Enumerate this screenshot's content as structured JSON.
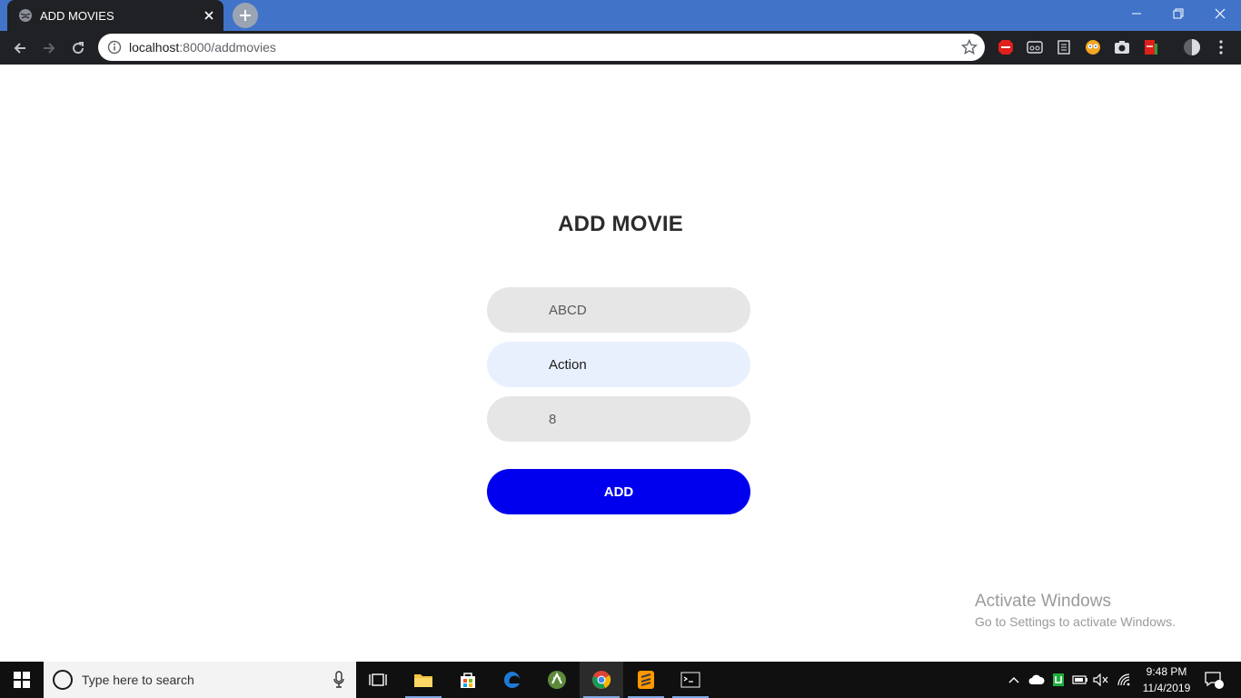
{
  "browser": {
    "tab_title": "ADD MOVIES",
    "url_host": "localhost",
    "url_rest": ":8000/addmovies"
  },
  "page": {
    "title": "ADD MOVIE",
    "fields": {
      "name_value": "ABCD",
      "genre_value": "Action",
      "rating_value": "8"
    },
    "add_label": "ADD"
  },
  "watermark": {
    "line1": "Activate Windows",
    "line2": "Go to Settings to activate Windows."
  },
  "taskbar": {
    "search_placeholder": "Type here to search",
    "time": "9:48 PM",
    "date": "11/4/2019",
    "notification_count": "1"
  },
  "colors": {
    "tab_strip": "#4174c9",
    "toolbar": "#202124",
    "add_button": "#0000ee",
    "autofill_field": "#e8f0fe",
    "field": "#e6e6e6"
  },
  "icons": [
    "globe-icon",
    "close-icon",
    "plus-icon",
    "minimize-icon",
    "restore-icon",
    "window-close-icon",
    "back-icon",
    "forward-icon",
    "reload-icon",
    "info-icon",
    "star-icon",
    "adblock-icon",
    "eyes-icon",
    "doc-icon",
    "face-icon",
    "camera-icon",
    "pdf-icon",
    "profile-icon",
    "menu-icon",
    "windows-icon",
    "mic-icon",
    "task-view-icon",
    "folder-icon",
    "store-icon",
    "edge-icon",
    "android-icon",
    "chrome-icon",
    "sublime-icon",
    "terminal-icon",
    "chevron-up-icon",
    "cloud-icon",
    "battery-icon",
    "volume-icon",
    "wifi-icon",
    "notification-icon"
  ]
}
